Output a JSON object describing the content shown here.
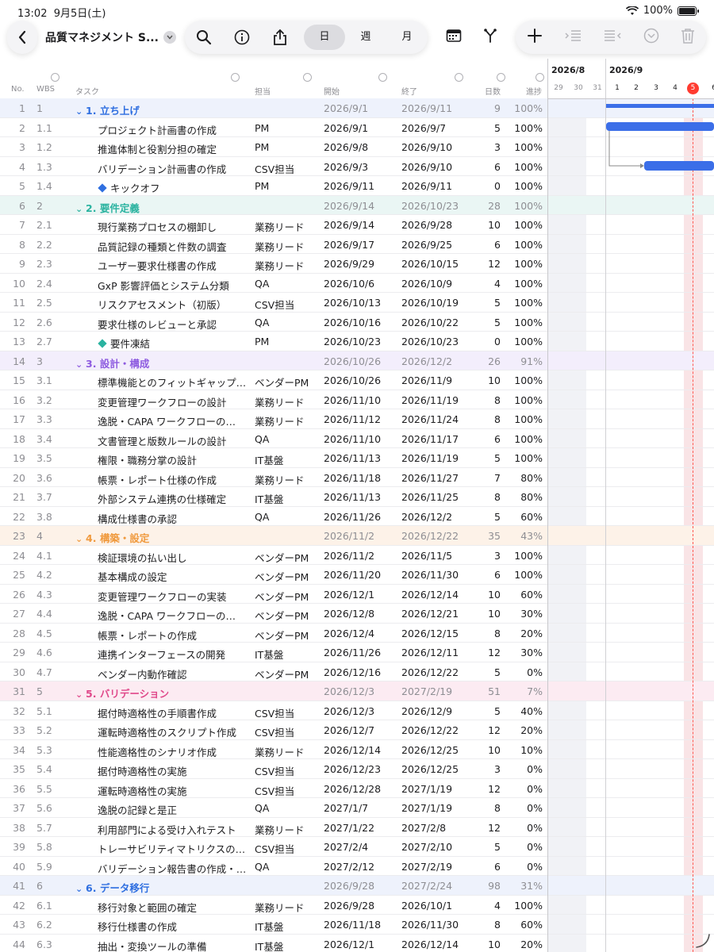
{
  "status": {
    "time": "13:02",
    "date": "9月5日(土)",
    "battery": "100%"
  },
  "toolbar": {
    "title": "品質マネジメント S...",
    "views": [
      "日",
      "週",
      "月"
    ],
    "selected_view": "日"
  },
  "columns": {
    "no": "No.",
    "wbs": "WBS",
    "task": "タスク",
    "owner": "担当",
    "start": "開始",
    "end": "終了",
    "days": "日数",
    "progress": "進捗"
  },
  "gantt": {
    "months": [
      "2026/8",
      "2026/9"
    ],
    "days": [
      "29",
      "30",
      "31",
      "1",
      "2",
      "3",
      "4",
      "5",
      "6"
    ],
    "today": "5"
  },
  "colors": {
    "g1": "#2f6fe0",
    "g2": "#2bb3a0",
    "g3": "#8e5ce0",
    "g4": "#f09a3e",
    "g5": "#e0488a",
    "g6": "#2f6fe0",
    "bg1": "#eef2fc",
    "bg2": "#eaf6f4",
    "bg3": "#f3eefc",
    "bg4": "#fdf2e8",
    "bg5": "#fcebf2",
    "bg6": "#eef2fc"
  },
  "rows": [
    {
      "no": "1",
      "wbs": "1",
      "task": "1. 立ち上げ",
      "owner": "",
      "start": "2026/9/1",
      "end": "2026/9/11",
      "days": "9",
      "progress": "100%",
      "group": "1"
    },
    {
      "no": "2",
      "wbs": "1.1",
      "task": "プロジェクト計画書の作成",
      "owner": "PM",
      "start": "2026/9/1",
      "end": "2026/9/7",
      "days": "5",
      "progress": "100%"
    },
    {
      "no": "3",
      "wbs": "1.2",
      "task": "推進体制と役割分担の確定",
      "owner": "PM",
      "start": "2026/9/8",
      "end": "2026/9/10",
      "days": "3",
      "progress": "100%"
    },
    {
      "no": "4",
      "wbs": "1.3",
      "task": "バリデーション計画書の作成",
      "owner": "CSV担当",
      "start": "2026/9/3",
      "end": "2026/9/10",
      "days": "6",
      "progress": "100%"
    },
    {
      "no": "5",
      "wbs": "1.4",
      "task": "キックオフ",
      "owner": "PM",
      "start": "2026/9/11",
      "end": "2026/9/11",
      "days": "0",
      "progress": "100%",
      "milestone": "g1"
    },
    {
      "no": "6",
      "wbs": "2",
      "task": "2. 要件定義",
      "owner": "",
      "start": "2026/9/14",
      "end": "2026/10/23",
      "days": "28",
      "progress": "100%",
      "group": "2"
    },
    {
      "no": "7",
      "wbs": "2.1",
      "task": "現行業務プロセスの棚卸し",
      "owner": "業務リード",
      "start": "2026/9/14",
      "end": "2026/9/28",
      "days": "10",
      "progress": "100%"
    },
    {
      "no": "8",
      "wbs": "2.2",
      "task": "品質記録の種類と件数の調査",
      "owner": "業務リード",
      "start": "2026/9/17",
      "end": "2026/9/25",
      "days": "6",
      "progress": "100%"
    },
    {
      "no": "9",
      "wbs": "2.3",
      "task": "ユーザー要求仕様書の作成",
      "owner": "業務リード",
      "start": "2026/9/29",
      "end": "2026/10/15",
      "days": "12",
      "progress": "100%"
    },
    {
      "no": "10",
      "wbs": "2.4",
      "task": "GxP 影響評価とシステム分類",
      "owner": "QA",
      "start": "2026/10/6",
      "end": "2026/10/9",
      "days": "4",
      "progress": "100%"
    },
    {
      "no": "11",
      "wbs": "2.5",
      "task": "リスクアセスメント（初版）",
      "owner": "CSV担当",
      "start": "2026/10/13",
      "end": "2026/10/19",
      "days": "5",
      "progress": "100%"
    },
    {
      "no": "12",
      "wbs": "2.6",
      "task": "要求仕様のレビューと承認",
      "owner": "QA",
      "start": "2026/10/16",
      "end": "2026/10/22",
      "days": "5",
      "progress": "100%"
    },
    {
      "no": "13",
      "wbs": "2.7",
      "task": "要件凍結",
      "owner": "PM",
      "start": "2026/10/23",
      "end": "2026/10/23",
      "days": "0",
      "progress": "100%",
      "milestone": "g2"
    },
    {
      "no": "14",
      "wbs": "3",
      "task": "3. 設計・構成",
      "owner": "",
      "start": "2026/10/26",
      "end": "2026/12/2",
      "days": "26",
      "progress": "91%",
      "group": "3"
    },
    {
      "no": "15",
      "wbs": "3.1",
      "task": "標準機能とのフィットギャップ…",
      "owner": "ベンダーPM",
      "start": "2026/10/26",
      "end": "2026/11/9",
      "days": "10",
      "progress": "100%"
    },
    {
      "no": "16",
      "wbs": "3.2",
      "task": "変更管理ワークフローの設計",
      "owner": "業務リード",
      "start": "2026/11/10",
      "end": "2026/11/19",
      "days": "8",
      "progress": "100%"
    },
    {
      "no": "17",
      "wbs": "3.3",
      "task": "逸脱・CAPA ワークフローの…",
      "owner": "業務リード",
      "start": "2026/11/12",
      "end": "2026/11/24",
      "days": "8",
      "progress": "100%"
    },
    {
      "no": "18",
      "wbs": "3.4",
      "task": "文書管理と版数ルールの設計",
      "owner": "QA",
      "start": "2026/11/10",
      "end": "2026/11/17",
      "days": "6",
      "progress": "100%"
    },
    {
      "no": "19",
      "wbs": "3.5",
      "task": "権限・職務分掌の設計",
      "owner": "IT基盤",
      "start": "2026/11/13",
      "end": "2026/11/19",
      "days": "5",
      "progress": "100%"
    },
    {
      "no": "20",
      "wbs": "3.6",
      "task": "帳票・レポート仕様の作成",
      "owner": "業務リード",
      "start": "2026/11/18",
      "end": "2026/11/27",
      "days": "7",
      "progress": "80%"
    },
    {
      "no": "21",
      "wbs": "3.7",
      "task": "外部システム連携の仕様確定",
      "owner": "IT基盤",
      "start": "2026/11/13",
      "end": "2026/11/25",
      "days": "8",
      "progress": "80%"
    },
    {
      "no": "22",
      "wbs": "3.8",
      "task": "構成仕様書の承認",
      "owner": "QA",
      "start": "2026/11/26",
      "end": "2026/12/2",
      "days": "5",
      "progress": "60%"
    },
    {
      "no": "23",
      "wbs": "4",
      "task": "4. 構築・設定",
      "owner": "",
      "start": "2026/11/2",
      "end": "2026/12/22",
      "days": "35",
      "progress": "43%",
      "group": "4"
    },
    {
      "no": "24",
      "wbs": "4.1",
      "task": "検証環境の払い出し",
      "owner": "ベンダーPM",
      "start": "2026/11/2",
      "end": "2026/11/5",
      "days": "3",
      "progress": "100%"
    },
    {
      "no": "25",
      "wbs": "4.2",
      "task": "基本構成の設定",
      "owner": "ベンダーPM",
      "start": "2026/11/20",
      "end": "2026/11/30",
      "days": "6",
      "progress": "100%"
    },
    {
      "no": "26",
      "wbs": "4.3",
      "task": "変更管理ワークフローの実装",
      "owner": "ベンダーPM",
      "start": "2026/12/1",
      "end": "2026/12/14",
      "days": "10",
      "progress": "60%"
    },
    {
      "no": "27",
      "wbs": "4.4",
      "task": "逸脱・CAPA ワークフローの…",
      "owner": "ベンダーPM",
      "start": "2026/12/8",
      "end": "2026/12/21",
      "days": "10",
      "progress": "30%"
    },
    {
      "no": "28",
      "wbs": "4.5",
      "task": "帳票・レポートの作成",
      "owner": "ベンダーPM",
      "start": "2026/12/4",
      "end": "2026/12/15",
      "days": "8",
      "progress": "20%"
    },
    {
      "no": "29",
      "wbs": "4.6",
      "task": "連携インターフェースの開発",
      "owner": "IT基盤",
      "start": "2026/11/26",
      "end": "2026/12/11",
      "days": "12",
      "progress": "30%"
    },
    {
      "no": "30",
      "wbs": "4.7",
      "task": "ベンダー内動作確認",
      "owner": "ベンダーPM",
      "start": "2026/12/16",
      "end": "2026/12/22",
      "days": "5",
      "progress": "0%"
    },
    {
      "no": "31",
      "wbs": "5",
      "task": "5. バリデーション",
      "owner": "",
      "start": "2026/12/3",
      "end": "2027/2/19",
      "days": "51",
      "progress": "7%",
      "group": "5"
    },
    {
      "no": "32",
      "wbs": "5.1",
      "task": "据付時適格性の手順書作成",
      "owner": "CSV担当",
      "start": "2026/12/3",
      "end": "2026/12/9",
      "days": "5",
      "progress": "40%"
    },
    {
      "no": "33",
      "wbs": "5.2",
      "task": "運転時適格性のスクリプト作成",
      "owner": "CSV担当",
      "start": "2026/12/7",
      "end": "2026/12/22",
      "days": "12",
      "progress": "20%"
    },
    {
      "no": "34",
      "wbs": "5.3",
      "task": "性能適格性のシナリオ作成",
      "owner": "業務リード",
      "start": "2026/12/14",
      "end": "2026/12/25",
      "days": "10",
      "progress": "10%"
    },
    {
      "no": "35",
      "wbs": "5.4",
      "task": "据付時適格性の実施",
      "owner": "CSV担当",
      "start": "2026/12/23",
      "end": "2026/12/25",
      "days": "3",
      "progress": "0%"
    },
    {
      "no": "36",
      "wbs": "5.5",
      "task": "運転時適格性の実施",
      "owner": "CSV担当",
      "start": "2026/12/28",
      "end": "2027/1/19",
      "days": "12",
      "progress": "0%"
    },
    {
      "no": "37",
      "wbs": "5.6",
      "task": "逸脱の記録と是正",
      "owner": "QA",
      "start": "2027/1/7",
      "end": "2027/1/19",
      "days": "8",
      "progress": "0%"
    },
    {
      "no": "38",
      "wbs": "5.7",
      "task": "利用部門による受け入れテスト",
      "owner": "業務リード",
      "start": "2027/1/22",
      "end": "2027/2/8",
      "days": "12",
      "progress": "0%"
    },
    {
      "no": "39",
      "wbs": "5.8",
      "task": "トレーサビリティマトリクスの…",
      "owner": "CSV担当",
      "start": "2027/2/4",
      "end": "2027/2/10",
      "days": "5",
      "progress": "0%"
    },
    {
      "no": "40",
      "wbs": "5.9",
      "task": "バリデーション報告書の作成・…",
      "owner": "QA",
      "start": "2027/2/12",
      "end": "2027/2/19",
      "days": "6",
      "progress": "0%"
    },
    {
      "no": "41",
      "wbs": "6",
      "task": "6. データ移行",
      "owner": "",
      "start": "2026/9/28",
      "end": "2027/2/24",
      "days": "98",
      "progress": "31%",
      "group": "6"
    },
    {
      "no": "42",
      "wbs": "6.1",
      "task": "移行対象と範囲の確定",
      "owner": "業務リード",
      "start": "2026/9/28",
      "end": "2026/10/1",
      "days": "4",
      "progress": "100%"
    },
    {
      "no": "43",
      "wbs": "6.2",
      "task": "移行仕様書の作成",
      "owner": "IT基盤",
      "start": "2026/11/18",
      "end": "2026/11/30",
      "days": "8",
      "progress": "60%"
    },
    {
      "no": "44",
      "wbs": "6.3",
      "task": "抽出・変換ツールの準備",
      "owner": "IT基盤",
      "start": "2026/12/1",
      "end": "2026/12/14",
      "days": "10",
      "progress": "20%"
    }
  ]
}
